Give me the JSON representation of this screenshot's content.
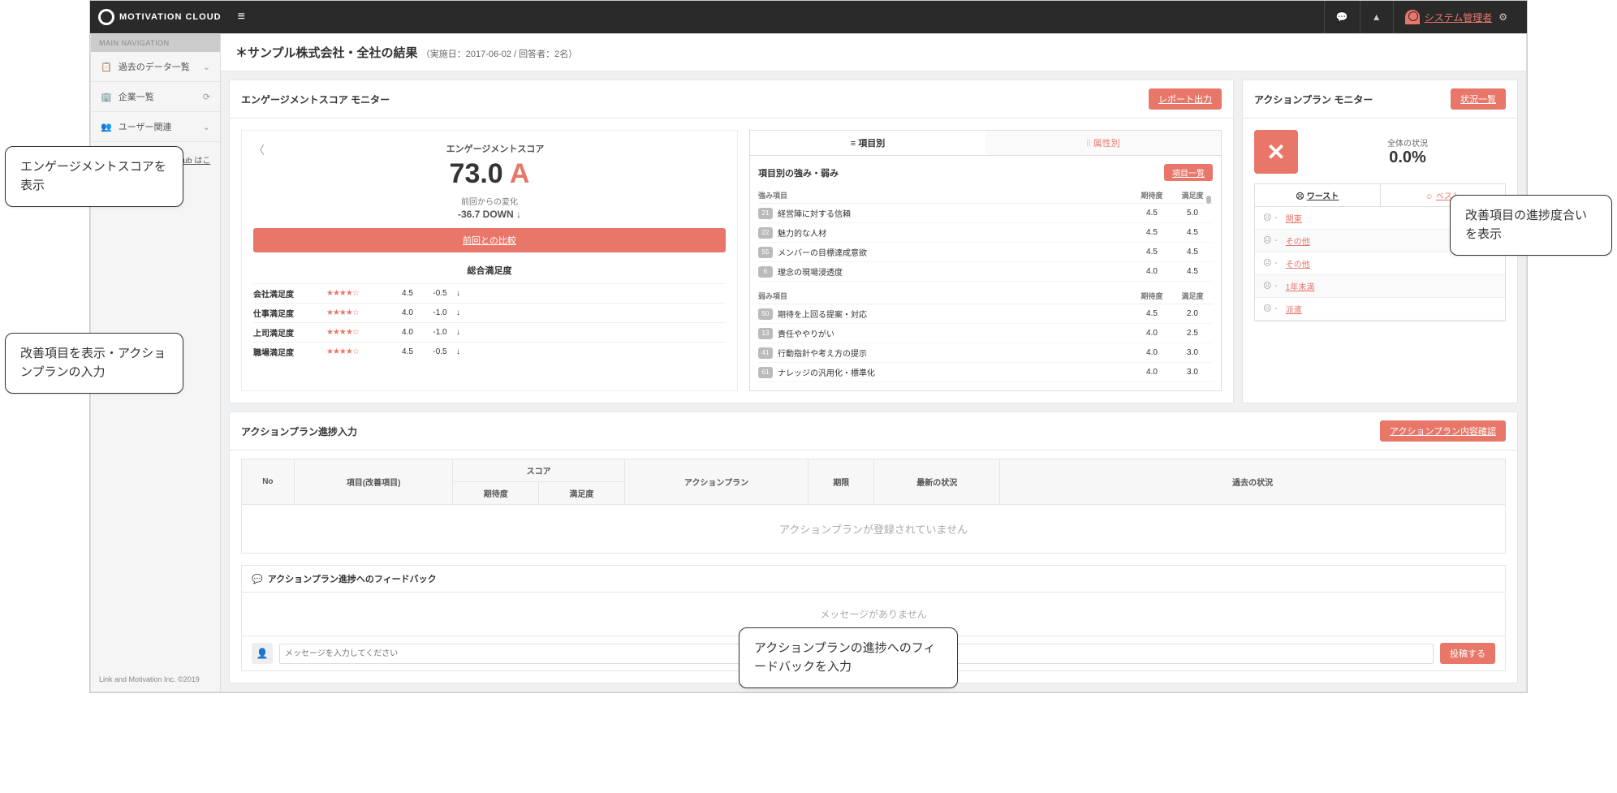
{
  "brand": "MOTIVATION CLOUD",
  "user_label": "システム管理者",
  "sidebar": {
    "nav_header": "MAIN NAVIGATION",
    "items": [
      {
        "icon": "📋",
        "label": "過去のデータ一覧"
      },
      {
        "icon": "🏢",
        "label": "企業一覧"
      },
      {
        "icon": "👥",
        "label": "ユーザー関連"
      }
    ],
    "club_link": "Motivation Company Club はこちら",
    "copyright": "Link and Motivation Inc. ©2019"
  },
  "page_title": "＊サンプル株式会社・全社の結果",
  "page_sub": "（実施日：2017-06-02 / 回答者：2名）",
  "engagement": {
    "title": "エンゲージメントスコア モニター",
    "report_btn": "レポート出力",
    "score_label": "エンゲージメントスコア",
    "score": "73.0",
    "grade": "A",
    "change_label": "前回からの変化",
    "change": "-36.7 DOWN ↓",
    "compare_btn": "前回との比較",
    "sat_title": "総合満足度",
    "sat_rows": [
      {
        "name": "会社満足度",
        "stars": "★★★★☆",
        "val": "4.5",
        "delta": "-0.5",
        "arr": "↓"
      },
      {
        "name": "仕事満足度",
        "stars": "★★★★☆",
        "val": "4.0",
        "delta": "-1.0",
        "arr": "↓"
      },
      {
        "name": "上司満足度",
        "stars": "★★★★☆",
        "val": "4.0",
        "delta": "-1.0",
        "arr": "↓"
      },
      {
        "name": "職場満足度",
        "stars": "★★★★☆",
        "val": "4.5",
        "delta": "-0.5",
        "arr": "↓"
      }
    ],
    "tab_item": "≡ 項目別",
    "tab_attr": "⫶⫶ 属性別",
    "items_title": "項目別の強み・弱み",
    "items_btn": "項目一覧",
    "th_strength": "強み項目",
    "th_weak": "弱み項目",
    "th_exp": "期待度",
    "th_sat": "満足度",
    "strengths": [
      {
        "n": "21",
        "label": "経営陣に対する信頼",
        "exp": "4.5",
        "sat": "5.0"
      },
      {
        "n": "22",
        "label": "魅力的な人材",
        "exp": "4.5",
        "sat": "4.5"
      },
      {
        "n": "55",
        "label": "メンバーの目標達成意欲",
        "exp": "4.5",
        "sat": "4.5"
      },
      {
        "n": "6",
        "label": "理念の現場浸透度",
        "exp": "4.0",
        "sat": "4.5"
      }
    ],
    "weaknesses": [
      {
        "n": "50",
        "label": "期待を上回る提案・対応",
        "exp": "4.5",
        "sat": "2.0"
      },
      {
        "n": "13",
        "label": "責任ややりがい",
        "exp": "4.0",
        "sat": "2.5"
      },
      {
        "n": "41",
        "label": "行動指針や考え方の提示",
        "exp": "4.0",
        "sat": "3.0"
      },
      {
        "n": "61",
        "label": "ナレッジの汎用化・標準化",
        "exp": "4.0",
        "sat": "3.0"
      }
    ]
  },
  "action_monitor": {
    "title": "アクションプラン モニター",
    "list_btn": "状況一覧",
    "overall_label": "全体の状況",
    "overall_pct": "0.0%",
    "tab_worst": "ワースト",
    "tab_best": "ベスト",
    "rows": [
      {
        "label": "関東",
        "val": "-"
      },
      {
        "label": "その他",
        "val": ""
      },
      {
        "label": "その他",
        "val": ""
      },
      {
        "label": "1年未満",
        "val": ""
      },
      {
        "label": "派遣",
        "val": ""
      }
    ]
  },
  "action_plan": {
    "title": "アクションプラン進捗入力",
    "confirm_btn": "アクションプラン内容確認",
    "th_no": "No",
    "th_item": "項目(改善項目)",
    "th_score": "スコア",
    "th_exp": "期待度",
    "th_sat": "満足度",
    "th_plan": "アクションプラン",
    "th_due": "期限",
    "th_latest": "最新の状況",
    "th_past": "過去の状況",
    "empty": "アクションプランが登録されていません"
  },
  "feedback": {
    "title": "アクションプラン進捗へのフィードバック",
    "empty": "メッセージがありません",
    "placeholder": "メッセージを入力してください",
    "post_btn": "投稿する"
  },
  "callouts": {
    "c1": "エンゲージメントスコアを表示",
    "c2": "改善項目を表示・アクションプランの入力",
    "c3": "改善項目の進捗度合いを表示",
    "c4": "アクションプランの進捗へのフィードバックを入力"
  }
}
